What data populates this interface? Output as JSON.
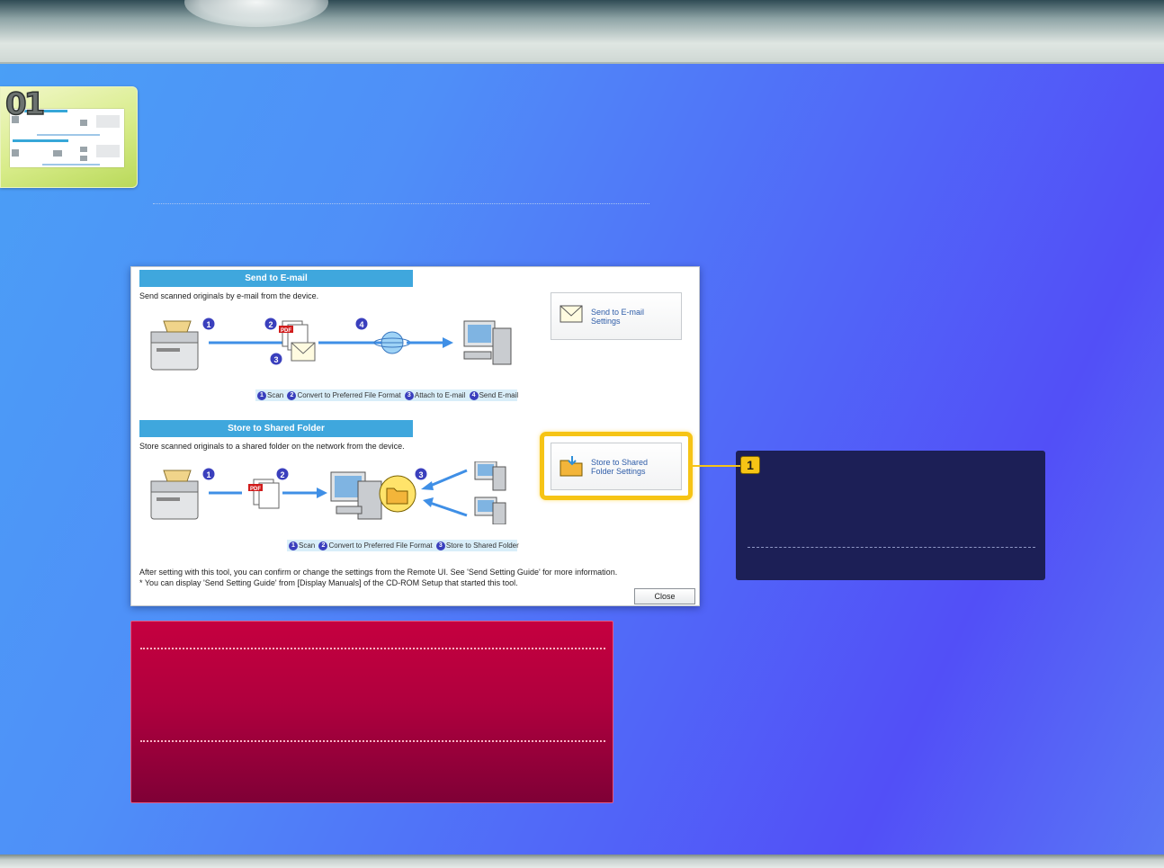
{
  "thumbnail": {
    "number": "01"
  },
  "screen": {
    "email_section": {
      "header": "Send to E-mail",
      "description": "Send scanned originals by e-mail from the device.",
      "steps": [
        "Scan",
        "Convert to Preferred File Format",
        "Attach to E-mail",
        "Send E-mail"
      ],
      "step_numbers": [
        "1",
        "2",
        "3",
        "4"
      ],
      "button_label": "Send to E-mail\nSettings"
    },
    "folder_section": {
      "header": "Store to Shared Folder",
      "description": "Store scanned originals to a shared folder on the network from the device.",
      "steps": [
        "Scan",
        "Convert to Preferred File Format",
        "Store to Shared Folder"
      ],
      "step_numbers": [
        "1",
        "2",
        "3"
      ],
      "button_label": "Store to Shared\nFolder Settings"
    },
    "note_line1": "After setting with this tool, you can confirm or change the settings from the Remote UI. See 'Send Setting Guide' for more information.",
    "note_line2": "* You can display 'Send Setting Guide' from [Display Manuals] of the CD-ROM Setup that started this tool.",
    "close_label": "Close",
    "pdf_label": "PDF"
  },
  "callout": {
    "number": "1"
  },
  "colors": {
    "accent_blue": "#3fa7dd",
    "highlight_yellow": "#f6c415",
    "info_navy": "#1c1f56",
    "note_red": "#b0003e"
  }
}
